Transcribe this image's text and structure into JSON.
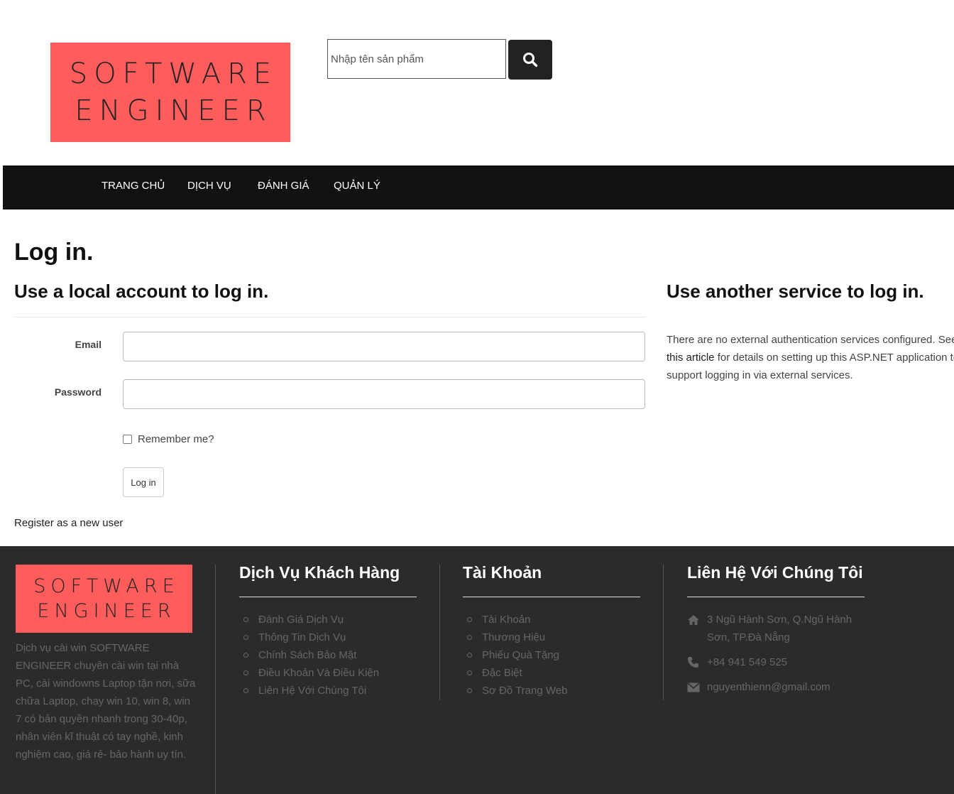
{
  "header": {
    "logo_line1": "SOFTWARE",
    "logo_line2": "ENGINEER",
    "search_placeholder": "Nhập tên sản phẩm",
    "search_icon": "search-icon"
  },
  "nav": {
    "items": [
      {
        "label": "TRANG CHỦ"
      },
      {
        "label": "DỊCH VỤ"
      },
      {
        "label": "ĐÁNH GIÁ"
      },
      {
        "label": "QUẢN LÝ"
      }
    ]
  },
  "main": {
    "title": "Log in.",
    "local_heading": "Use a local account to log in.",
    "email_label": "Email",
    "password_label": "Password",
    "remember_label": "Remember me?",
    "login_button": "Log in",
    "register_link": "Register as a new user",
    "external_heading": "Use another service to log in.",
    "external_line1": "There are no external authentication services configured. See",
    "external_link": "this article",
    "external_line2_rest": " for details on setting up this ASP.NET application to",
    "external_line3": "support logging in via external services."
  },
  "footer": {
    "logo_line1": "SOFTWARE",
    "logo_line2": "ENGINEER",
    "description": "Dịch vụ cài win SOFTWARE ENGINEER chuyên cài win tại nhà PC, cài windowns Laptop tận nơi, sữa chữa Laptop, chạy win 10, win 8, win 7 có bản quyền nhanh trong 30-40p, nhân viên kĩ thuật có tay nghề, kinh nghiệm cao, giá rẻ- bảo hành uy tín.",
    "col1": {
      "title": "Dịch Vụ Khách Hàng",
      "items": [
        "Đánh Giá Dịch Vụ",
        "Thông Tin Dịch Vụ",
        "Chính Sách Bảo Mật",
        "Điều Khoản Và Điều Kiện",
        "Liên Hệ Với Chúng Tôi"
      ]
    },
    "col2": {
      "title": "Tài Khoản",
      "items": [
        "Tài Khoản",
        "Thương Hiệu",
        "Phiếu Quà Tặng",
        "Đặc Biệt",
        "Sơ Đồ Trang Web"
      ]
    },
    "col3": {
      "title": "Liên Hệ Với Chúng Tôi",
      "address": "3 Ngũ Hành Sơn, Q.Ngũ Hành Sơn, TP.Đà Nẵng",
      "phone": "+84 941 549 525",
      "email": "nguyenthienn@gmail.com"
    }
  },
  "colors": {
    "brand_red": "#ff5c5c",
    "navbar_bg": "#111111",
    "footer_bg": "#2b2b2b"
  }
}
